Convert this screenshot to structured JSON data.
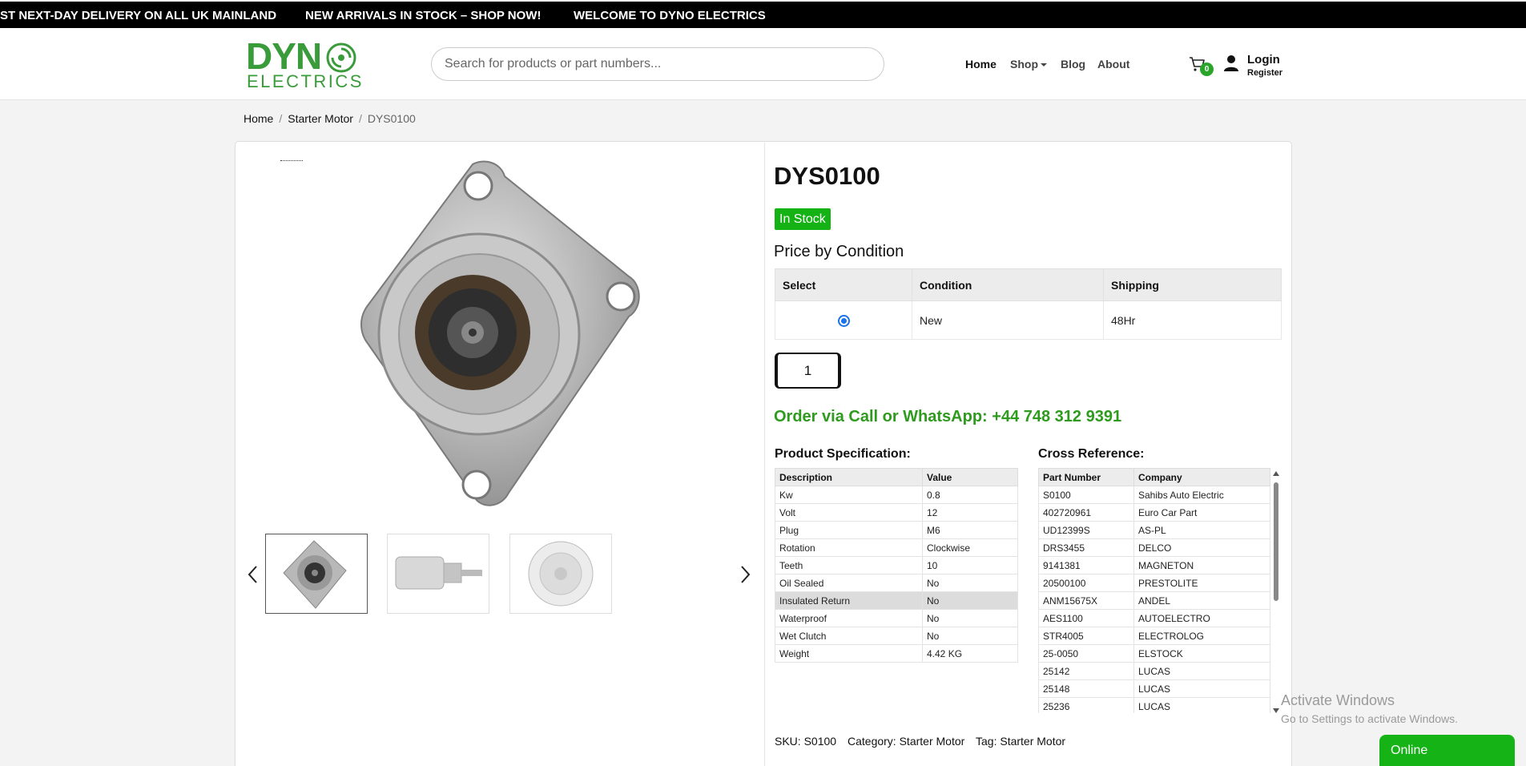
{
  "announcements": [
    "ST NEXT-DAY DELIVERY ON ALL UK MAINLAND",
    "NEW ARRIVALS IN STOCK – SHOP NOW!",
    "WELCOME TO DYNO ELECTRICS"
  ],
  "logo": {
    "line1": "DYN",
    "line2": "ELECTRICS"
  },
  "search": {
    "placeholder": "Search for products or part numbers..."
  },
  "nav": {
    "home": "Home",
    "shop": "Shop",
    "blog": "Blog",
    "about": "About"
  },
  "cart": {
    "count": "0"
  },
  "account": {
    "login": "Login",
    "register": "Register"
  },
  "breadcrumb": {
    "home": "Home",
    "category": "Starter Motor",
    "current": "DYS0100"
  },
  "product": {
    "title": "DYS0100",
    "stock": "In Stock",
    "price_heading": "Price by Condition",
    "quantity": "1",
    "order_text": "Order via Call or WhatsApp: +44 748 312 9391"
  },
  "price_table": {
    "headers": [
      "Select",
      "Condition",
      "Shipping"
    ],
    "rows": [
      {
        "condition": "New",
        "shipping": "48Hr"
      }
    ]
  },
  "spec": {
    "heading": "Product Specification:",
    "headers": [
      "Description",
      "Value"
    ],
    "rows": [
      [
        "Kw",
        "0.8"
      ],
      [
        "Volt",
        "12"
      ],
      [
        "Plug",
        "M6"
      ],
      [
        "Rotation",
        "Clockwise"
      ],
      [
        "Teeth",
        "10"
      ],
      [
        "Oil Sealed",
        "No"
      ],
      [
        "Insulated Return",
        "No"
      ],
      [
        "Waterproof",
        "No"
      ],
      [
        "Wet Clutch",
        "No"
      ],
      [
        "Weight",
        "4.42 KG"
      ]
    ]
  },
  "xref": {
    "heading": "Cross Reference:",
    "headers": [
      "Part Number",
      "Company"
    ],
    "rows": [
      [
        "S0100",
        "Sahibs Auto Electric"
      ],
      [
        "402720961",
        "Euro Car Part"
      ],
      [
        "UD12399S",
        "AS-PL"
      ],
      [
        "DRS3455",
        "DELCO"
      ],
      [
        "9141381",
        "MAGNETON"
      ],
      [
        "20500100",
        "PRESTOLITE"
      ],
      [
        "ANM15675X",
        "ANDEL"
      ],
      [
        "AES1100",
        "AUTOELECTRO"
      ],
      [
        "STR4005",
        "ELECTROLOG"
      ],
      [
        "25-0050",
        "ELSTOCK"
      ],
      [
        "25142",
        "LUCAS"
      ],
      [
        "25148",
        "LUCAS"
      ],
      [
        "25236",
        "LUCAS"
      ]
    ]
  },
  "meta": {
    "sku": "SKU: S0100",
    "category": "Category: Starter Motor",
    "tag": "Tag: Starter Motor"
  },
  "windows": {
    "line1": "Activate Windows",
    "line2": "Go to Settings to activate Windows."
  },
  "chat": {
    "status": "Online"
  },
  "colors": {
    "brand_green": "#3a9b3a",
    "stock_green": "#15b215",
    "order_green": "#2e9a1e"
  }
}
